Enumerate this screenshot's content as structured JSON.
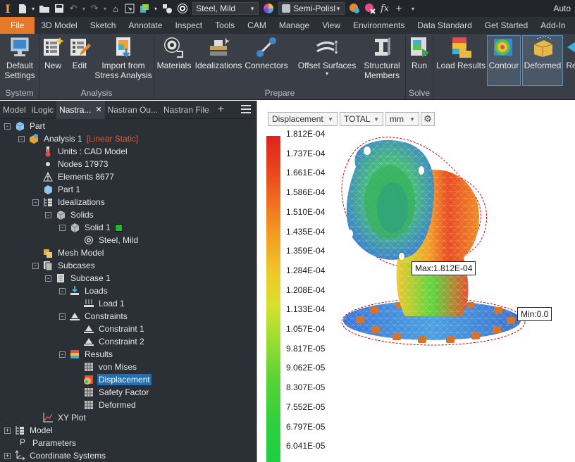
{
  "titlebar": {
    "material": "Steel, Mild",
    "appearance": "Semi-Polisl",
    "app_title": "Auto",
    "fx_label": "fx"
  },
  "tabs": [
    "File",
    "3D Model",
    "Sketch",
    "Annotate",
    "Inspect",
    "Tools",
    "CAM",
    "Manage",
    "View",
    "Environments",
    "Data Standard",
    "Get Started",
    "Add-In"
  ],
  "ribbon": {
    "default_settings": "Default\nSettings",
    "new": "New",
    "edit": "Edit",
    "import_stress": "Import from\nStress Analysis",
    "materials": "Materials",
    "idealizations": "Idealizations",
    "connectors": "Connectors",
    "offset_surfaces": "Offset Surfaces",
    "structural_members": "Structural\nMembers",
    "run": "Run",
    "load_results": "Load Results",
    "contour": "Contour",
    "deformed": "Deformed",
    "re": "Re",
    "groups": {
      "system": "System",
      "analysis": "Analysis",
      "prepare": "Prepare",
      "solve": "Solve"
    }
  },
  "browser": {
    "tabs": [
      "Model",
      "iLogic",
      "Nastra...",
      "Nastran Ou...",
      "Nastran File"
    ],
    "tree": [
      {
        "label": "Part",
        "exp": "-"
      },
      {
        "label": "Analysis 1",
        "extra": "[Linear Static]",
        "exp": "-"
      },
      {
        "label": "Units : CAD Model"
      },
      {
        "label": "Nodes 17973"
      },
      {
        "label": "Elements 8677"
      },
      {
        "label": "Part 1"
      },
      {
        "label": "Idealizations",
        "exp": "-"
      },
      {
        "label": "Solids",
        "exp": "-"
      },
      {
        "label": "Solid 1",
        "exp": "-"
      },
      {
        "label": "Steel, Mild"
      },
      {
        "label": "Mesh Model"
      },
      {
        "label": "Subcases",
        "exp": "-"
      },
      {
        "label": "Subcase 1",
        "exp": "-"
      },
      {
        "label": "Loads",
        "exp": "-"
      },
      {
        "label": "Load 1"
      },
      {
        "label": "Constraints",
        "exp": "-"
      },
      {
        "label": "Constraint 1"
      },
      {
        "label": "Constraint 2"
      },
      {
        "label": "Results",
        "exp": "-"
      },
      {
        "label": "von Mises"
      },
      {
        "label": "Displacement"
      },
      {
        "label": "Safety Factor"
      },
      {
        "label": "Deformed"
      },
      {
        "label": "XY Plot"
      },
      {
        "label": "Model",
        "exp": "+"
      },
      {
        "label": "Parameters"
      },
      {
        "label": "Coordinate Systems",
        "exp": "+"
      }
    ]
  },
  "viewport": {
    "result_type": "Displacement",
    "component": "TOTAL",
    "units": "mm",
    "legend_values": [
      "1.812E-04",
      "1.737E-04",
      "1.661E-04",
      "1.586E-04",
      "1.510E-04",
      "1.435E-04",
      "1.359E-04",
      "1.284E-04",
      "1.208E-04",
      "1.133E-04",
      "1.057E-04",
      "9.817E-05",
      "9.062E-05",
      "8.307E-05",
      "7.552E-05",
      "6.797E-05",
      "6.041E-05"
    ],
    "max_label": "Max:1.812E-04",
    "min_label": "Min:0.0"
  }
}
